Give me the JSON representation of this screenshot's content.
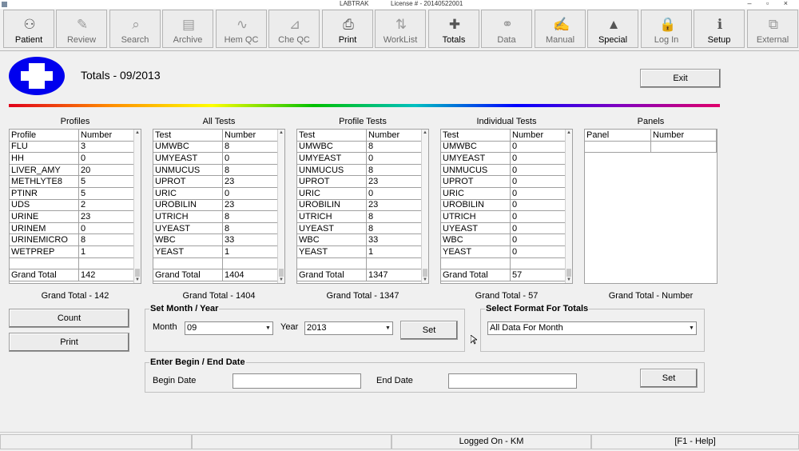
{
  "window": {
    "title": "LABTRAK",
    "license": "License # - 20140522001",
    "controls": "– ▫ ×"
  },
  "toolbar": [
    {
      "label": "Patient",
      "icon": "patient-icon",
      "glyph": "⚇",
      "active": true
    },
    {
      "label": "Review",
      "icon": "review-icon",
      "glyph": "✎",
      "active": false
    },
    {
      "label": "Search",
      "icon": "search-icon",
      "glyph": "⌕",
      "active": false
    },
    {
      "label": "Archive",
      "icon": "archive-icon",
      "glyph": "▤",
      "active": false
    },
    {
      "label": "Hem QC",
      "icon": "hem-qc-icon",
      "glyph": "∿",
      "active": false
    },
    {
      "label": "Che QC",
      "icon": "che-qc-icon",
      "glyph": "⊿",
      "active": false
    },
    {
      "label": "Print",
      "icon": "printer-icon",
      "glyph": "⎙",
      "active": true
    },
    {
      "label": "WorkList",
      "icon": "worklist-icon",
      "glyph": "⇅",
      "active": false
    },
    {
      "label": "Totals",
      "icon": "totals-plus-icon",
      "glyph": "✚",
      "active": true
    },
    {
      "label": "Data",
      "icon": "data-icon",
      "glyph": "⚭",
      "active": false
    },
    {
      "label": "Manual",
      "icon": "manual-icon",
      "glyph": "✍",
      "active": false
    },
    {
      "label": "Special",
      "icon": "special-icon",
      "glyph": "▲",
      "active": true
    },
    {
      "label": "Log In",
      "icon": "lock-icon",
      "glyph": "🔒",
      "active": false
    },
    {
      "label": "Setup",
      "icon": "info-icon",
      "glyph": "ℹ",
      "active": true
    },
    {
      "label": "External",
      "icon": "external-icon",
      "glyph": "⧉",
      "active": false
    }
  ],
  "header": {
    "title": "Totals - 09/2013",
    "exit_label": "Exit"
  },
  "grids": {
    "profiles": {
      "title": "Profiles",
      "col1": "Profile",
      "col2": "Number",
      "rows": [
        [
          "FLU",
          "3"
        ],
        [
          "HH",
          "0"
        ],
        [
          "LIVER_AMY",
          "20"
        ],
        [
          "METHLYTE8",
          "5"
        ],
        [
          "PTINR",
          "5"
        ],
        [
          "UDS",
          "2"
        ],
        [
          "URINE",
          "23"
        ],
        [
          "URINEM",
          "0"
        ],
        [
          "URINEMICRO",
          "8"
        ],
        [
          "WETPREP",
          "1"
        ],
        [
          "",
          ""
        ],
        [
          "Grand Total",
          "142"
        ]
      ],
      "grand_total": "Grand Total - 142"
    },
    "all_tests": {
      "title": "All Tests",
      "col1": "Test",
      "col2": "Number",
      "rows": [
        [
          "UMWBC",
          "8"
        ],
        [
          "UMYEAST",
          "0"
        ],
        [
          "UNMUCUS",
          "8"
        ],
        [
          "UPROT",
          "23"
        ],
        [
          "URIC",
          "0"
        ],
        [
          "UROBILIN",
          "23"
        ],
        [
          "UTRICH",
          "8"
        ],
        [
          "UYEAST",
          "8"
        ],
        [
          "WBC",
          "33"
        ],
        [
          "YEAST",
          "1"
        ],
        [
          "",
          ""
        ],
        [
          "Grand Total",
          "1404"
        ]
      ],
      "grand_total": "Grand Total - 1404"
    },
    "profile_tests": {
      "title": "Profile Tests",
      "col1": "Test",
      "col2": "Number",
      "rows": [
        [
          "UMWBC",
          "8"
        ],
        [
          "UMYEAST",
          "0"
        ],
        [
          "UNMUCUS",
          "8"
        ],
        [
          "UPROT",
          "23"
        ],
        [
          "URIC",
          "0"
        ],
        [
          "UROBILIN",
          "23"
        ],
        [
          "UTRICH",
          "8"
        ],
        [
          "UYEAST",
          "8"
        ],
        [
          "WBC",
          "33"
        ],
        [
          "YEAST",
          "1"
        ],
        [
          "",
          ""
        ],
        [
          "Grand Total",
          "1347"
        ]
      ],
      "grand_total": "Grand Total - 1347"
    },
    "individual_tests": {
      "title": "Individual Tests",
      "col1": "Test",
      "col2": "Number",
      "rows": [
        [
          "UMWBC",
          "0"
        ],
        [
          "UMYEAST",
          "0"
        ],
        [
          "UNMUCUS",
          "0"
        ],
        [
          "UPROT",
          "0"
        ],
        [
          "URIC",
          "0"
        ],
        [
          "UROBILIN",
          "0"
        ],
        [
          "UTRICH",
          "0"
        ],
        [
          "UYEAST",
          "0"
        ],
        [
          "WBC",
          "0"
        ],
        [
          "YEAST",
          "0"
        ],
        [
          "",
          ""
        ],
        [
          "Grand Total",
          "57"
        ]
      ],
      "grand_total": "Grand Total - 57"
    },
    "panels": {
      "title": "Panels",
      "col1": "Panel",
      "col2": "Number",
      "rows": [
        [
          "",
          ""
        ]
      ],
      "grand_total": "Grand Total - Number"
    }
  },
  "actions": {
    "count_label": "Count",
    "print_label": "Print"
  },
  "month_year": {
    "legend": "Set Month / Year",
    "month_label": "Month",
    "month_value": "09",
    "year_label": "Year",
    "year_value": "2013",
    "set_label": "Set"
  },
  "format": {
    "legend": "Select Format For Totals",
    "value": "All Data For Month"
  },
  "date_range": {
    "legend": "Enter Begin / End Date",
    "begin_label": "Begin Date",
    "begin_value": "",
    "end_label": "End Date",
    "end_value": "",
    "set_label": "Set"
  },
  "status": {
    "logged_on": "Logged On - KM",
    "help": "[F1 - Help]"
  },
  "colors": {
    "logo_blue": "#0000ee",
    "background": "#f0f0f0"
  }
}
